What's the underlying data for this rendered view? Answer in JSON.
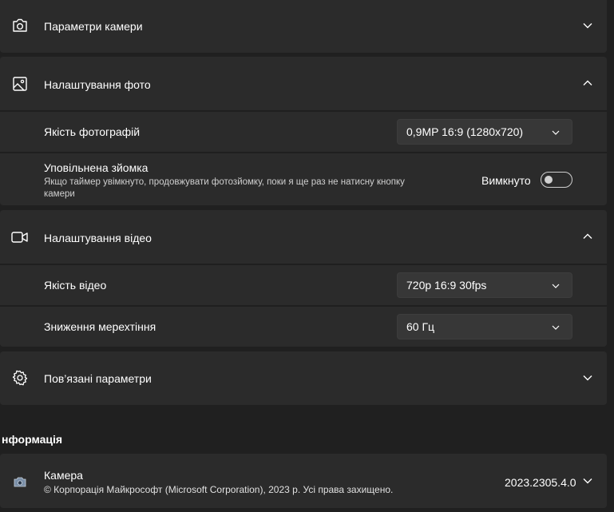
{
  "camera_settings": {
    "label": "Параметри камери"
  },
  "photo_settings": {
    "label": "Налаштування фото",
    "quality": {
      "label": "Якість фотографій",
      "value": "0,9MP 16:9 (1280x720)"
    },
    "timelapse": {
      "label": "Уповільнена зйомка",
      "description_line1": "Якщо таймер увімкнуто, продовжувати фотозйомку, поки я ще раз не натисну кнопку",
      "description_line2": "камери",
      "state": "Вимкнуто"
    }
  },
  "video_settings": {
    "label": "Налаштування відео",
    "quality": {
      "label": "Якість відео",
      "value": "720p 16:9 30fps"
    },
    "flicker": {
      "label": "Зниження мерехтіння",
      "value": "60 Гц"
    }
  },
  "related_settings": {
    "label": "Пов’язані параметри"
  },
  "info": {
    "section_title": "нформація",
    "app_name": "Камера",
    "copyright": "© Корпорація Майкрософт (Microsoft Corporation), 2023 р. Усі права захищено.",
    "version": "2023.2305.4.0"
  },
  "colors": {
    "background": "#202020",
    "card": "#2b2b2b",
    "select": "#373737"
  },
  "icons": [
    "camera-icon",
    "image-icon",
    "video-icon",
    "gear-icon",
    "chevron-down-icon",
    "chevron-up-icon",
    "camera-app-icon"
  ]
}
